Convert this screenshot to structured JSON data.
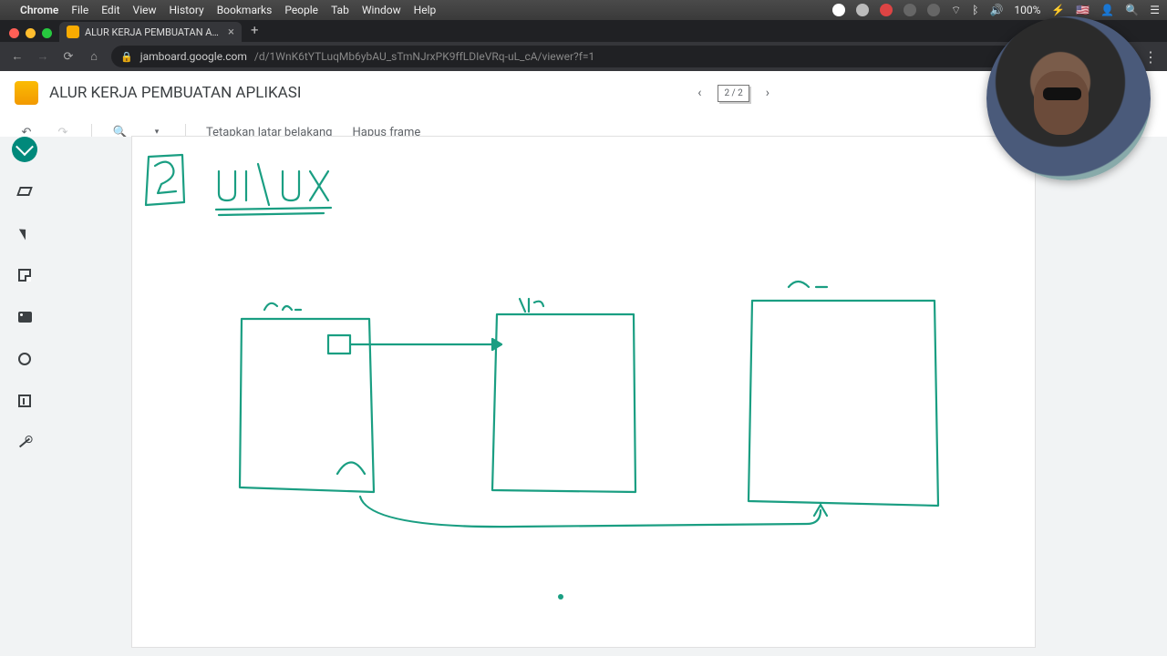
{
  "mac_menu": {
    "app": "Chrome",
    "items": [
      "File",
      "Edit",
      "View",
      "History",
      "Bookmarks",
      "People",
      "Tab",
      "Window",
      "Help"
    ],
    "battery": "100%",
    "battery_icon_label": "⚡"
  },
  "browser": {
    "tab_title": "ALUR KERJA PEMBUATAN APL",
    "new_tab_glyph": "+",
    "close_glyph": "×",
    "url_host": "jamboard.google.com",
    "url_path": "/d/1WnK6tYTLuqMb6ybAU_sTmNJrxPK9ffLDIeVRq-uL_cA/viewer?f=1",
    "lock_glyph": "🔒",
    "menu_glyph": "⋮"
  },
  "jamboard": {
    "doc_title": "ALUR KERJA PEMBUATAN APLIKASI",
    "frame_indicator": "2 / 2",
    "prev_glyph": "‹",
    "next_glyph": "›",
    "toolbar": {
      "undo_glyph": "↶",
      "redo_glyph": "↷",
      "zoom_glyph": "🔍",
      "zoom_caret": "▾",
      "set_background": "Tetapkan latar belakang",
      "clear_frame": "Hapus frame"
    },
    "tools": {
      "pen": "pen",
      "eraser": "eraser",
      "select": "select",
      "sticky": "sticky-note",
      "image": "image",
      "circle": "shape",
      "textbox": "text-box",
      "laser": "laser"
    }
  },
  "canvas": {
    "stroke_color": "#1a9e82",
    "title_text_1": "2",
    "title_text_2": "UI / UX",
    "box_labels": [
      "Rev",
      "Log",
      "Ca-"
    ]
  }
}
